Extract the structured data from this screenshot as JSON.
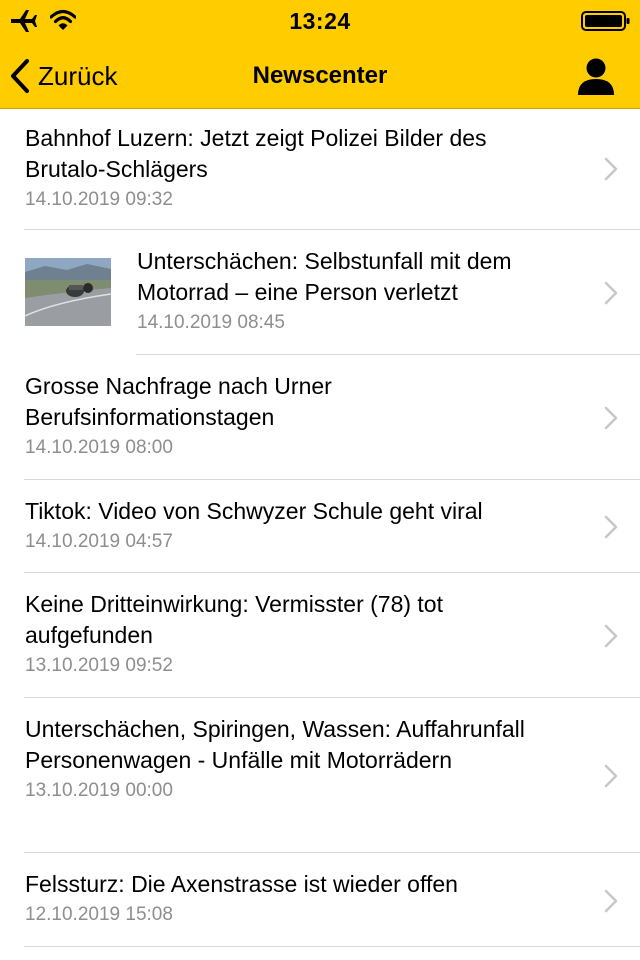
{
  "status_bar": {
    "time": "13:24"
  },
  "navbar": {
    "back_label": "Zurück",
    "title": "Newscenter",
    "background": "#FFCC00"
  },
  "news": [
    {
      "title": "Bahnhof Luzern: Jetzt zeigt Polizei Bilder des Brutalo-Schlägers",
      "date": "14.10.2019 09:32",
      "has_thumbnail": false
    },
    {
      "title": "Unterschächen: Selbstunfall mit dem Motorrad – eine Person verletzt",
      "date": "14.10.2019 08:45",
      "has_thumbnail": true
    },
    {
      "title": "Grosse Nachfrage nach Urner Berufsinformationstagen",
      "date": "14.10.2019 08:00",
      "has_thumbnail": false
    },
    {
      "title": "Tiktok: Video von Schwyzer Schule geht viral",
      "date": "14.10.2019 04:57",
      "has_thumbnail": false
    },
    {
      "title": "Keine Dritteinwirkung: Vermisster (78) tot aufgefunden",
      "date": "13.10.2019 09:52",
      "has_thumbnail": false
    },
    {
      "title": "Unterschächen, Spiringen, Wassen: Auffahrunfall Personenwagen - Unfälle mit Motorrädern",
      "date": "13.10.2019 00:00",
      "has_thumbnail": false
    },
    {
      "title": "Felssturz: Die Axenstrasse ist wieder offen",
      "date": "12.10.2019 15:08",
      "has_thumbnail": false
    }
  ]
}
